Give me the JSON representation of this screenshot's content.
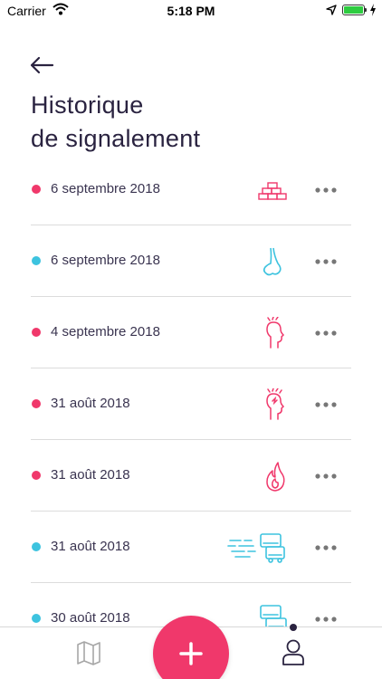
{
  "status_bar": {
    "carrier": "Carrier",
    "time": "5:18 PM"
  },
  "header": {
    "title_line1": "Historique",
    "title_line2": "de signalement"
  },
  "colors": {
    "pink": "#f0386b",
    "cyan": "#3dc3df",
    "text": "#2a2340"
  },
  "reports": [
    {
      "date": "6 septembre 2018",
      "dot": "pink",
      "icon": "bricks-icon"
    },
    {
      "date": "6 septembre 2018",
      "dot": "cyan",
      "icon": "nose-icon"
    },
    {
      "date": "4 septembre 2018",
      "dot": "pink",
      "icon": "head-stress-icon"
    },
    {
      "date": "31 août 2018",
      "dot": "pink",
      "icon": "head-stress-icon"
    },
    {
      "date": "31 août 2018",
      "dot": "pink",
      "icon": "fire-icon"
    },
    {
      "date": "31 août 2018",
      "dot": "cyan",
      "icon": "wind-traffic-icon"
    },
    {
      "date": "30 août 2018",
      "dot": "cyan",
      "icon": "traffic-icon"
    }
  ],
  "tab_bar": {
    "items": [
      "map-icon",
      "add-icon",
      "profile-icon"
    ]
  }
}
